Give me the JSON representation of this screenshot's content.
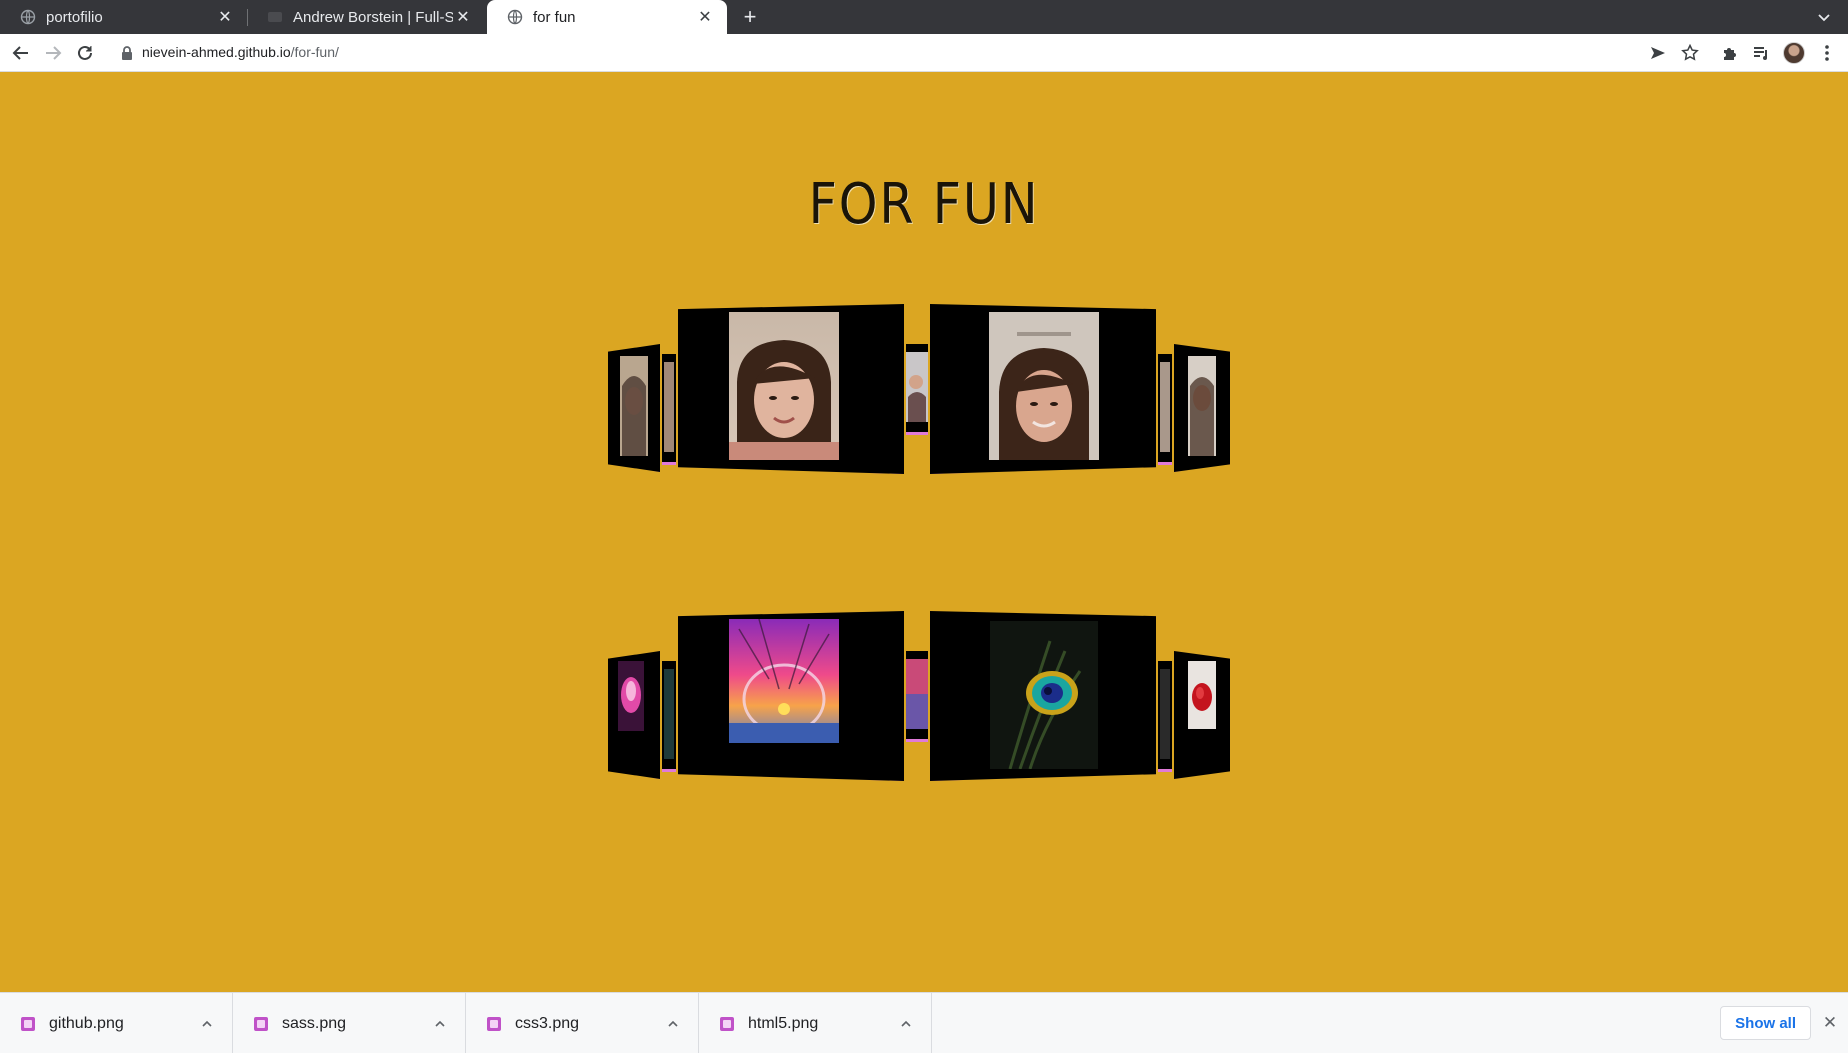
{
  "browser": {
    "tabs": [
      {
        "title": "portofilio",
        "active": false
      },
      {
        "title": "Andrew Borstein | Full-Stack Developer",
        "active": false
      },
      {
        "title": "for fun",
        "active": true
      }
    ],
    "address": {
      "domain": "nievein-ahmed.github.io",
      "path": "/for-fun/"
    }
  },
  "page": {
    "title": "FOR FUN",
    "background": "#dba622",
    "accent_glow": "#e07ad8"
  },
  "downloads": {
    "items": [
      {
        "name": "github.png"
      },
      {
        "name": "sass.png"
      },
      {
        "name": "css3.png"
      },
      {
        "name": "html5.png"
      }
    ],
    "show_all": "Show all"
  }
}
